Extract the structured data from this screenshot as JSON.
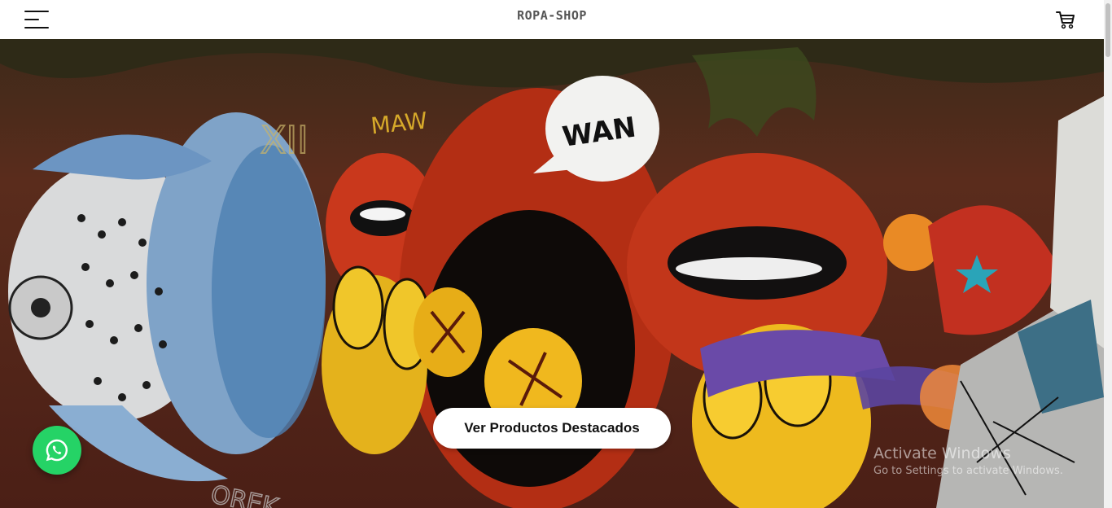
{
  "header": {
    "logo": "ROPA-SHOP",
    "menu_icon": "hamburger-menu-icon",
    "cart_icon": "shopping-cart-icon"
  },
  "hero": {
    "image": "graffiti-mural",
    "cta_label": "Ver Productos Destacados"
  },
  "whatsapp": {
    "icon": "whatsapp-icon",
    "color": "#25d366"
  },
  "watermark": {
    "title": "Activate Windows",
    "subtitle": "Go to Settings to activate Windows."
  }
}
